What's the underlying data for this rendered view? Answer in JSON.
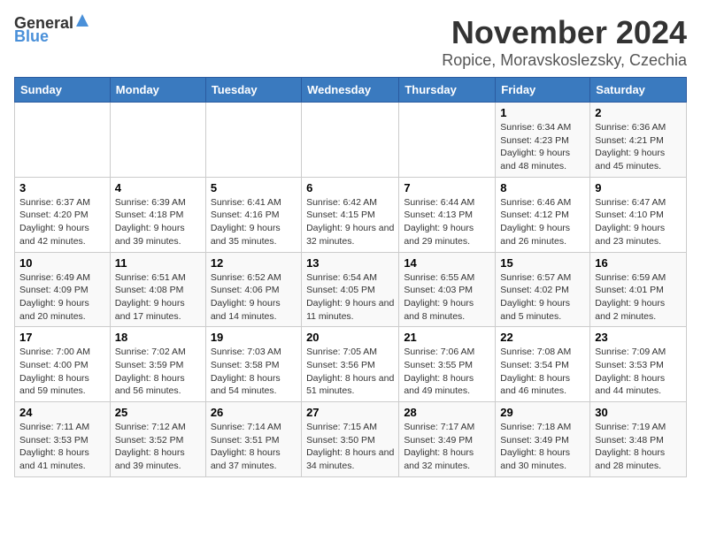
{
  "logo": {
    "general": "General",
    "blue": "Blue"
  },
  "title": "November 2024",
  "location": "Ropice, Moravskoslezsky, Czechia",
  "days_of_week": [
    "Sunday",
    "Monday",
    "Tuesday",
    "Wednesday",
    "Thursday",
    "Friday",
    "Saturday"
  ],
  "weeks": [
    [
      {
        "day": null,
        "info": null
      },
      {
        "day": null,
        "info": null
      },
      {
        "day": null,
        "info": null
      },
      {
        "day": null,
        "info": null
      },
      {
        "day": null,
        "info": null
      },
      {
        "day": "1",
        "info": "Sunrise: 6:34 AM\nSunset: 4:23 PM\nDaylight: 9 hours and 48 minutes."
      },
      {
        "day": "2",
        "info": "Sunrise: 6:36 AM\nSunset: 4:21 PM\nDaylight: 9 hours and 45 minutes."
      }
    ],
    [
      {
        "day": "3",
        "info": "Sunrise: 6:37 AM\nSunset: 4:20 PM\nDaylight: 9 hours and 42 minutes."
      },
      {
        "day": "4",
        "info": "Sunrise: 6:39 AM\nSunset: 4:18 PM\nDaylight: 9 hours and 39 minutes."
      },
      {
        "day": "5",
        "info": "Sunrise: 6:41 AM\nSunset: 4:16 PM\nDaylight: 9 hours and 35 minutes."
      },
      {
        "day": "6",
        "info": "Sunrise: 6:42 AM\nSunset: 4:15 PM\nDaylight: 9 hours and 32 minutes."
      },
      {
        "day": "7",
        "info": "Sunrise: 6:44 AM\nSunset: 4:13 PM\nDaylight: 9 hours and 29 minutes."
      },
      {
        "day": "8",
        "info": "Sunrise: 6:46 AM\nSunset: 4:12 PM\nDaylight: 9 hours and 26 minutes."
      },
      {
        "day": "9",
        "info": "Sunrise: 6:47 AM\nSunset: 4:10 PM\nDaylight: 9 hours and 23 minutes."
      }
    ],
    [
      {
        "day": "10",
        "info": "Sunrise: 6:49 AM\nSunset: 4:09 PM\nDaylight: 9 hours and 20 minutes."
      },
      {
        "day": "11",
        "info": "Sunrise: 6:51 AM\nSunset: 4:08 PM\nDaylight: 9 hours and 17 minutes."
      },
      {
        "day": "12",
        "info": "Sunrise: 6:52 AM\nSunset: 4:06 PM\nDaylight: 9 hours and 14 minutes."
      },
      {
        "day": "13",
        "info": "Sunrise: 6:54 AM\nSunset: 4:05 PM\nDaylight: 9 hours and 11 minutes."
      },
      {
        "day": "14",
        "info": "Sunrise: 6:55 AM\nSunset: 4:03 PM\nDaylight: 9 hours and 8 minutes."
      },
      {
        "day": "15",
        "info": "Sunrise: 6:57 AM\nSunset: 4:02 PM\nDaylight: 9 hours and 5 minutes."
      },
      {
        "day": "16",
        "info": "Sunrise: 6:59 AM\nSunset: 4:01 PM\nDaylight: 9 hours and 2 minutes."
      }
    ],
    [
      {
        "day": "17",
        "info": "Sunrise: 7:00 AM\nSunset: 4:00 PM\nDaylight: 8 hours and 59 minutes."
      },
      {
        "day": "18",
        "info": "Sunrise: 7:02 AM\nSunset: 3:59 PM\nDaylight: 8 hours and 56 minutes."
      },
      {
        "day": "19",
        "info": "Sunrise: 7:03 AM\nSunset: 3:58 PM\nDaylight: 8 hours and 54 minutes."
      },
      {
        "day": "20",
        "info": "Sunrise: 7:05 AM\nSunset: 3:56 PM\nDaylight: 8 hours and 51 minutes."
      },
      {
        "day": "21",
        "info": "Sunrise: 7:06 AM\nSunset: 3:55 PM\nDaylight: 8 hours and 49 minutes."
      },
      {
        "day": "22",
        "info": "Sunrise: 7:08 AM\nSunset: 3:54 PM\nDaylight: 8 hours and 46 minutes."
      },
      {
        "day": "23",
        "info": "Sunrise: 7:09 AM\nSunset: 3:53 PM\nDaylight: 8 hours and 44 minutes."
      }
    ],
    [
      {
        "day": "24",
        "info": "Sunrise: 7:11 AM\nSunset: 3:53 PM\nDaylight: 8 hours and 41 minutes."
      },
      {
        "day": "25",
        "info": "Sunrise: 7:12 AM\nSunset: 3:52 PM\nDaylight: 8 hours and 39 minutes."
      },
      {
        "day": "26",
        "info": "Sunrise: 7:14 AM\nSunset: 3:51 PM\nDaylight: 8 hours and 37 minutes."
      },
      {
        "day": "27",
        "info": "Sunrise: 7:15 AM\nSunset: 3:50 PM\nDaylight: 8 hours and 34 minutes."
      },
      {
        "day": "28",
        "info": "Sunrise: 7:17 AM\nSunset: 3:49 PM\nDaylight: 8 hours and 32 minutes."
      },
      {
        "day": "29",
        "info": "Sunrise: 7:18 AM\nSunset: 3:49 PM\nDaylight: 8 hours and 30 minutes."
      },
      {
        "day": "30",
        "info": "Sunrise: 7:19 AM\nSunset: 3:48 PM\nDaylight: 8 hours and 28 minutes."
      }
    ]
  ]
}
